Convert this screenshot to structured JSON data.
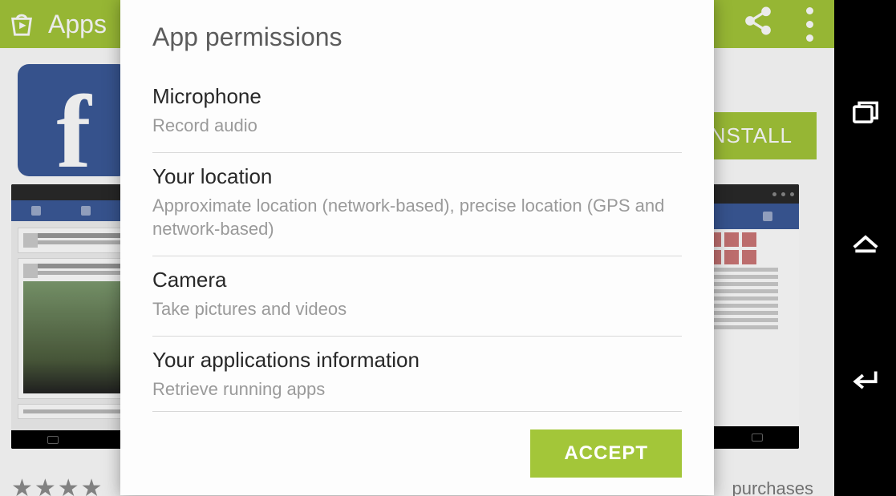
{
  "action_bar": {
    "title": "Apps"
  },
  "app_detail": {
    "install_label": "INSTALL",
    "purchases_label": "purchases",
    "stars": "★★★★"
  },
  "dialog": {
    "title": "App permissions",
    "permissions": [
      {
        "name": "Microphone",
        "desc": "Record audio"
      },
      {
        "name": "Your location",
        "desc": "Approximate location (network-based), precise location (GPS and network-based)"
      },
      {
        "name": "Camera",
        "desc": "Take pictures and videos"
      },
      {
        "name": "Your applications information",
        "desc": "Retrieve running apps"
      }
    ],
    "accept_label": "ACCEPT"
  }
}
